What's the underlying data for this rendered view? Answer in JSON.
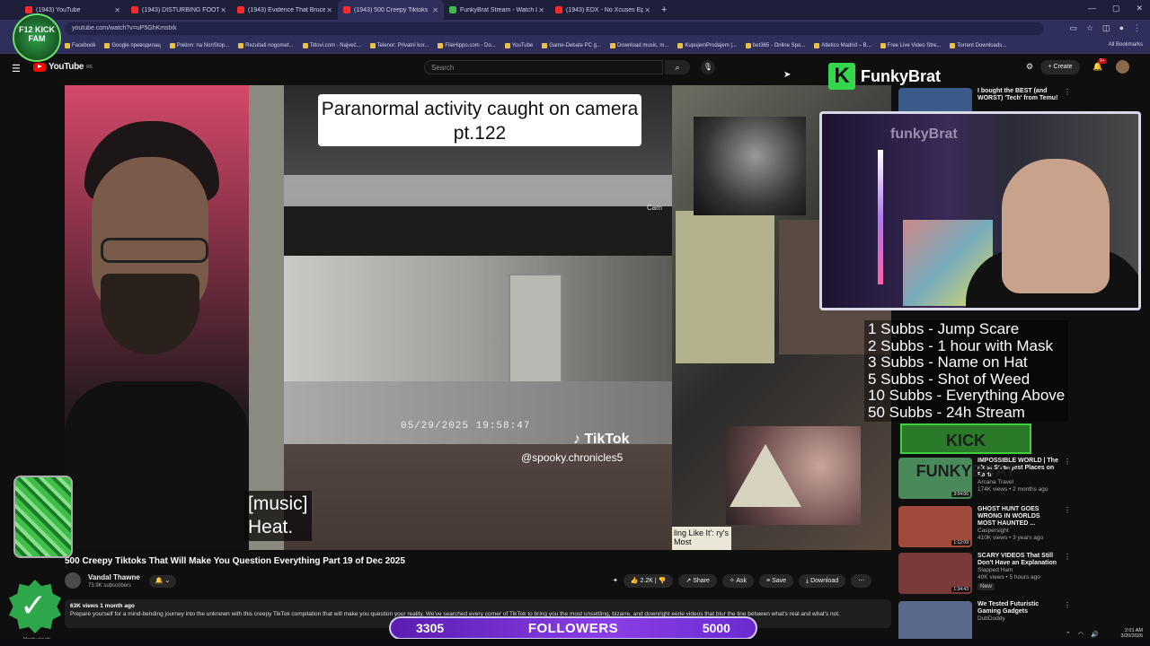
{
  "browser": {
    "tabs": [
      {
        "label": "(1943) YouTube",
        "active": false
      },
      {
        "label": "(1943) DISTURBING FOOTAGE I",
        "active": false
      },
      {
        "label": "(1943) Evidence That Bruce Le",
        "active": false
      },
      {
        "label": "(1943) 500 Creepy Tiktoks",
        "active": true
      },
      {
        "label": "FunkyBrat Stream - Watch Live",
        "active": false
      },
      {
        "label": "(1943) EDX - No Xcuses Ep",
        "active": false
      }
    ],
    "new_tab": "+",
    "url": "youtube.com/watch?v=uP5GhKmstxk",
    "bookmarks": [
      "Facebook",
      "Google преводилац",
      "Poklon: na NonStop...",
      "Rezultati nogomet...",
      "Titlovi.com - Najveć...",
      "Telenor: Privatni kor...",
      "FileHippo.com - Do...",
      "YouTube",
      "Game-Debate PC g...",
      "Download music, m...",
      "KupujemProdajem |...",
      "bet365 - Online Spo...",
      "Atletico Madrid – B...",
      "Free Live Video Stre...",
      "Torrent Downloads..."
    ],
    "all_bookmarks": "All Bookmarks"
  },
  "youtube": {
    "logo": "YouTube",
    "country": "RS",
    "search_placeholder": "Search",
    "create_label": "Create",
    "notif_count": "9+"
  },
  "video": {
    "tiktok_title": "Paranormal activity caught on camera pt.122",
    "timestamp": "05/29/2025 19:58:47",
    "tiktok_logo": "TikTok",
    "handle": "@spooky.chronicles5",
    "caption_line1": "[music]",
    "caption_line2": "Heat.",
    "collage_label": "ling Like It': ry's Most",
    "cam_tag": "Cam"
  },
  "watch": {
    "title": "500 Creepy Tiktoks That Will Make You Question Everything Part 19 of Dec 2025",
    "channel": "Vandal Thawne",
    "subscribers": "73.9K subscribers",
    "likes": "2.2K",
    "share": "Share",
    "ask": "Ask",
    "save": "Save",
    "download": "Download",
    "views_date": "63K views  1 month ago",
    "description": "Prepare yourself for a mind-bending journey into the unknown with this creepy TikTok compilation that will make you question your reality. We've searched every corner of TikTok to bring you the most unsettling, bizarre, and downright eerie videos that blur the line between what's real and what's not."
  },
  "sidebar": [
    {
      "title": "I bought the BEST (and WORST) 'Tech' from Temu!",
      "channel": "",
      "meta": "",
      "duration": "",
      "thumb": "#3a5a8a"
    },
    {
      "title": "IMPOSSIBLE WORLD | The Most Strangest Places on Earth",
      "channel": "Arcana Travel",
      "meta": "174K views • 2 months ago",
      "duration": "3:04:06",
      "thumb": "#4a8a5a"
    },
    {
      "title": "GHOST HUNT GOES WRONG IN WORLDS MOST HAUNTED ...",
      "channel": "Caspersight",
      "meta": "410K views • 3 years ago",
      "duration": "1:12:09",
      "thumb": "#a04a3a"
    },
    {
      "title": "SCARY VIDEOS That Still Don't Have an Explanation",
      "channel": "Slapped Ham",
      "meta": "40K views • 5 hours ago",
      "duration": "1:34:43",
      "thumb": "#7a3a3a",
      "badge": "New"
    },
    {
      "title": "We Tested Futuristic Gaming Gadgets",
      "channel": "DubDoddy",
      "meta": "",
      "duration": "",
      "thumb": "#5a6a8a"
    }
  ],
  "stream_overlay": {
    "brand_letter": "K",
    "brand_name": "FunkyBrat",
    "webcam_logo": "funkyBrat",
    "goals": [
      "1 Subbs - Jump Scare",
      "2 Subbs - 1 hour with Mask",
      "3 Subbs - Name on Hat",
      "5 Subbs - Shot of Weed",
      "10 Subbs - Everything Above",
      "50 Subbs - 24h Stream"
    ],
    "kick_banner": "KICK FUNKYBRAT",
    "f12_badge": "F12 KICK FAM",
    "followers_current": "3305",
    "followers_label": "FOLLOWERS",
    "followers_goal": "5000",
    "followers_progress": 0.661,
    "weather": "Mostly cloudy"
  },
  "system": {
    "time": "2:01 AM",
    "date": "3/20/2026"
  }
}
